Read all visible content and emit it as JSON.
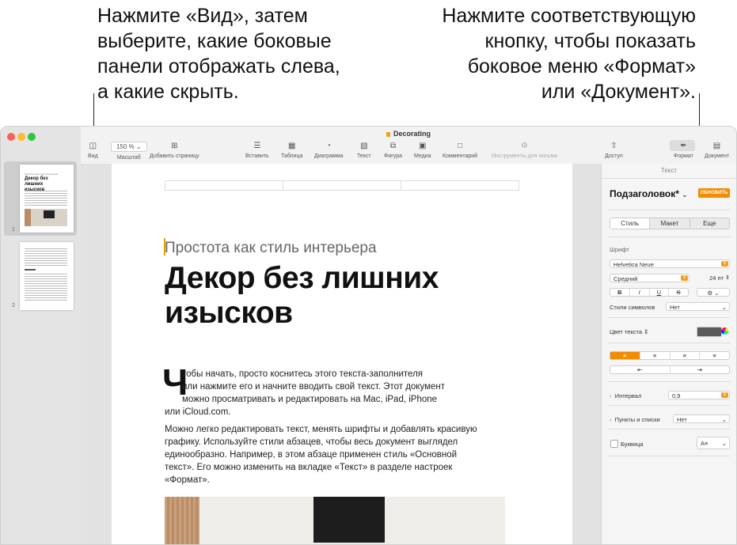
{
  "callouts": {
    "left": [
      "Нажмите «Вид», затем",
      "выберите, какие боковые",
      "панели отображать слева,",
      "а какие скрыть."
    ],
    "right": [
      "Нажмите соответствующую",
      "кнопку, чтобы показать",
      "боковое меню «Формат»",
      "или «Документ»."
    ]
  },
  "window": {
    "title": "Decorating"
  },
  "toolbar": {
    "view": "Вид",
    "zoom_value": "150 %",
    "zoom": "Масштаб",
    "add_page": "Добавить страницу",
    "insert": "Вставить",
    "table": "Таблица",
    "chart": "Диаграмма",
    "text": "Текст",
    "shape": "Фигура",
    "media": "Медиа",
    "comment": "Комментарий",
    "mail_tools": "Инструменты для письма",
    "share": "Доступ",
    "format": "Формат",
    "document": "Документ"
  },
  "thumbnails": {
    "page1_subtitle": "Простота как стиль интерьера",
    "page1_title": "Декор без лишних изысков",
    "page1_number": "1",
    "page2_number": "2"
  },
  "document": {
    "subtitle": "Простота как стиль интерьера",
    "heading_lines": [
      "Декор без лишних",
      "изысков"
    ],
    "dropcap": "Ч",
    "para1_lines": [
      "тобы начать, просто коснитесь этого текста-заполнителя",
      "или нажмите его и начните вводить свой текст. Этот документ",
      "можно просматривать и редактировать на Mac, iPad, iPhone",
      "или iCloud.com."
    ],
    "para2_lines": [
      "Можно легко редактировать текст, менять шрифты и добавлять красивую",
      "графику. Используйте стили абзацев, чтобы весь документ выглядел",
      "единообразно. Например, в этом абзаце применен стиль «Основной",
      "текст». Его можно изменить на вкладке «Текст» в разделе настроек",
      "«Формат»."
    ]
  },
  "inspector": {
    "title": "Текст",
    "paragraph_style": "Подзаголовок*",
    "update": "ОБНОВИТЬ",
    "tabs": [
      "Стиль",
      "Макет",
      "Еще"
    ],
    "font_label": "Шрифт",
    "font_name": "Helvetica Neue",
    "font_weight": "Средний",
    "font_size": "24 пт",
    "bold": "B",
    "italic": "I",
    "underline": "U",
    "strike": "S",
    "char_styles_label": "Стили символов",
    "char_styles_value": "Нет",
    "text_color_label": "Цвет текста",
    "text_color": "#5a5a5a",
    "accent_color": "#f28c00",
    "spacing_label": "Интервал",
    "spacing_value": "0,9",
    "bullets_label": "Пункты и списки",
    "bullets_value": "Нет",
    "dropcap_label": "Буквица"
  }
}
